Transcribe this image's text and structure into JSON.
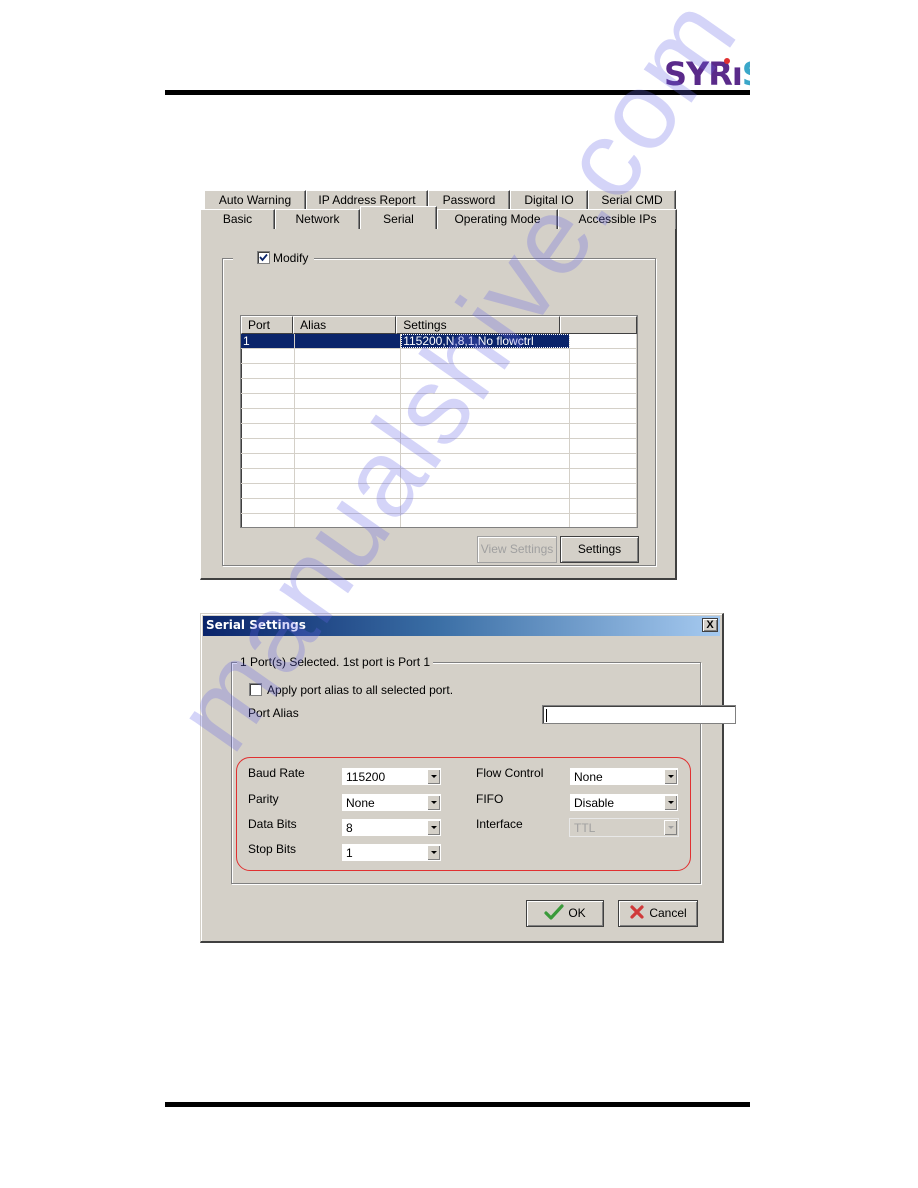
{
  "header": {
    "logo_text": "SYRIS",
    "logo_colors": {
      "s": "#3aa7c9",
      "yr": "#5a2a8a",
      "dot": "#e03030"
    }
  },
  "properties_panel": {
    "tabs_back_row": [
      {
        "label": "Auto Warning"
      },
      {
        "label": "IP Address Report"
      },
      {
        "label": "Password"
      },
      {
        "label": "Digital IO"
      },
      {
        "label": "Serial CMD"
      }
    ],
    "tabs_front_row": [
      {
        "label": "Basic",
        "active": false
      },
      {
        "label": "Network",
        "active": false
      },
      {
        "label": "Serial",
        "active": true
      },
      {
        "label": "Operating Mode",
        "active": false
      },
      {
        "label": "Accessible IPs",
        "active": false
      }
    ],
    "modify_checkbox": {
      "label": "Modify",
      "checked": true
    },
    "port_table": {
      "columns": [
        "Port",
        "Alias",
        "Settings",
        ""
      ],
      "rows": [
        {
          "port": "1",
          "alias": "",
          "settings": "115200,N,8,1,No flowctrl",
          "selected": true
        }
      ],
      "empty_rows": 12
    },
    "view_settings_button": {
      "label": "View Settings",
      "enabled": false
    },
    "settings_button": {
      "label": "Settings",
      "enabled": true
    }
  },
  "serial_settings_dialog": {
    "title": "Serial Settings",
    "close_label": "X",
    "group_label": "1 Port(s) Selected. 1st port is Port 1",
    "apply_alias_checkbox": {
      "label": "Apply port alias to all selected port.",
      "checked": false
    },
    "port_alias": {
      "label": "Port Alias",
      "value": ""
    },
    "fields_left": [
      {
        "label": "Baud Rate",
        "value": "115200"
      },
      {
        "label": "Parity",
        "value": "None"
      },
      {
        "label": "Data Bits",
        "value": "8"
      },
      {
        "label": "Stop Bits",
        "value": "1"
      }
    ],
    "fields_right": [
      {
        "label": "Flow Control",
        "value": "None",
        "enabled": true
      },
      {
        "label": "FIFO",
        "value": "Disable",
        "enabled": true
      },
      {
        "label": "Interface",
        "value": "TTL",
        "enabled": false
      }
    ],
    "ok_button": {
      "label": "OK"
    },
    "cancel_button": {
      "label": "Cancel"
    },
    "highlight_color": "#e03030"
  },
  "watermark": {
    "text": "manualshive.com"
  }
}
